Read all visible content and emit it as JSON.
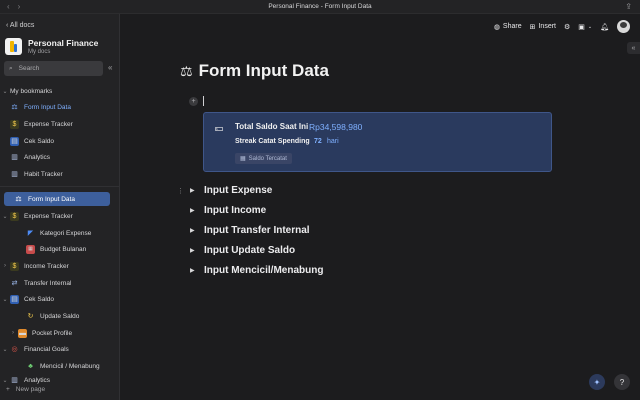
{
  "window": {
    "title": "Personal Finance - Form Input Data"
  },
  "sidebar": {
    "back_label": "All docs",
    "workspace_name": "Personal Finance",
    "workspace_sub": "My docs",
    "search_placeholder": "Search",
    "bookmarks_header": "My bookmarks",
    "bookmarks": [
      {
        "label": "Form Input Data",
        "icon": "scale-icon"
      },
      {
        "label": "Expense Tracker",
        "icon": "money-bag-icon"
      },
      {
        "label": "Cek Saldo",
        "icon": "pages-icon"
      },
      {
        "label": "Analytics",
        "icon": "doc-icon"
      },
      {
        "label": "Habit Tracker",
        "icon": "doc-icon"
      }
    ],
    "tree": [
      {
        "label": "Form Input Data",
        "icon": "scale-icon"
      },
      {
        "label": "Expense Tracker",
        "icon": "money-bag-icon"
      },
      {
        "label": "Kategori Expense",
        "icon": "tag-icon"
      },
      {
        "label": "Budget Bulanan",
        "icon": "calendar-icon"
      },
      {
        "label": "Income Tracker",
        "icon": "money-bag-icon"
      },
      {
        "label": "Transfer Internal",
        "icon": "transfer-icon"
      },
      {
        "label": "Cek Saldo",
        "icon": "pages-icon"
      },
      {
        "label": "Update Saldo",
        "icon": "refresh-icon"
      },
      {
        "label": "Pocket Profile",
        "icon": "wallet-icon"
      },
      {
        "label": "Financial Goals",
        "icon": "target-icon"
      },
      {
        "label": "Mencicil / Menabung",
        "icon": "plant-icon"
      },
      {
        "label": "Analytics",
        "icon": "doc-icon"
      }
    ],
    "new_page": "New page"
  },
  "toolbar": {
    "share": "Share",
    "insert": "Insert"
  },
  "main": {
    "title": "Form Input Data",
    "callout": {
      "total_label": "Total Saldo Saat Ini",
      "total_value": "Rp34,598,980",
      "streak_label": "Streak Catat Spending",
      "streak_value": "72",
      "streak_unit": "hari",
      "chip": "Saldo Tercatat"
    },
    "toggles": [
      "Input Expense",
      "Input Income",
      "Input Transfer Internal",
      "Input Update Saldo",
      "Input Mencicil/Menabung"
    ]
  },
  "help_label": "?"
}
